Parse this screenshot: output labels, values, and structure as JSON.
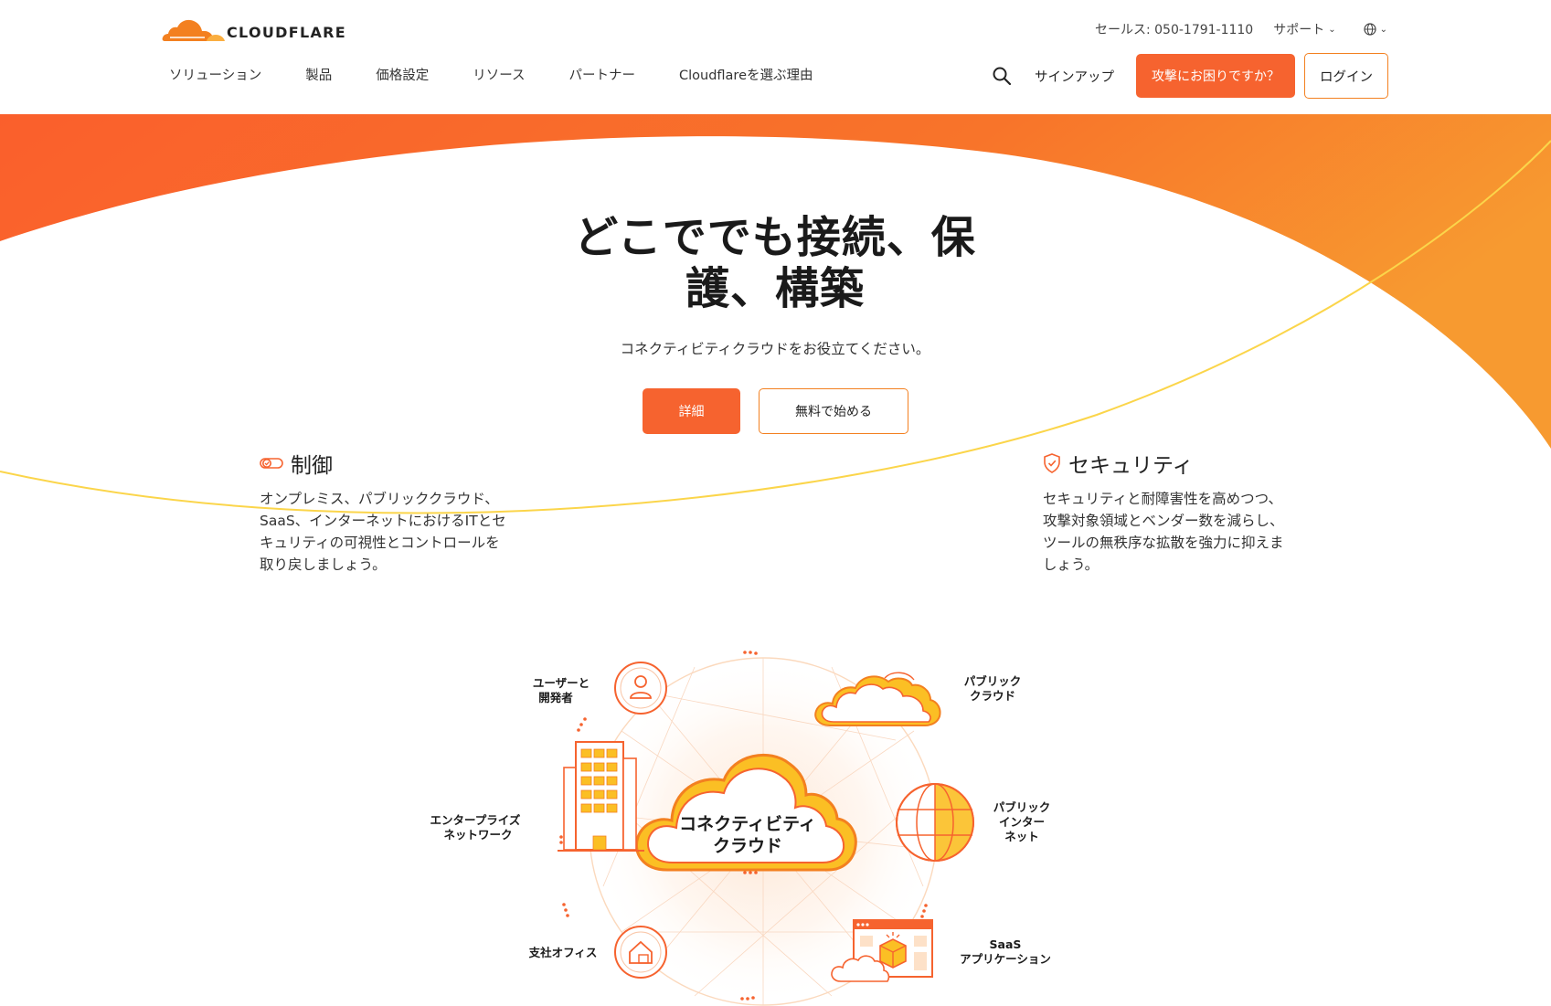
{
  "header": {
    "logo_text": "CLOUDFLARE",
    "sales": "セールス: 050-1791-1110",
    "support": "サポート",
    "nav": [
      "ソリューション",
      "製品",
      "価格設定",
      "リソース",
      "パートナー",
      "Cloudflareを選ぶ理由"
    ],
    "signup": "サインアップ",
    "attack_button": "攻撃にお困りですか？",
    "login_button": "ログイン"
  },
  "hero": {
    "title_line1": "どこででも接続、保",
    "title_line2": "護、構築",
    "subtitle": "コネクティビティクラウドをお役立てください。",
    "detail_button": "詳細",
    "free_button": "無料で始める"
  },
  "features": {
    "control": {
      "title": "制御",
      "lines": [
        "オンプレミス、パブリッククラウド、",
        "SaaS、インターネットにおけるITとセ",
        "キュリティの可視性とコントロールを",
        "取り戻しましょう。"
      ]
    },
    "security": {
      "title": "セキュリティ",
      "lines": [
        "セキュリティと耐障害性を高めつつ、",
        "攻撃対象領域とベンダー数を減らし、",
        "ツールの無秩序な拡散を強力に抑えま",
        "しょう。"
      ]
    }
  },
  "diagram": {
    "center": [
      "コネクティビティ",
      "クラウド"
    ],
    "users": [
      "ユーザーと",
      "開発者"
    ],
    "public_cloud": [
      "パブリック",
      "クラウド"
    ],
    "enterprise": [
      "エンタープライズ",
      "ネットワーク"
    ],
    "public_internet": [
      "パブリック",
      "インター",
      "ネット"
    ],
    "branch": [
      "支社オフィス"
    ],
    "saas": [
      "SaaS",
      "アプリケーション"
    ]
  },
  "colors": {
    "accent": "#f6632f",
    "orange": "#f38020",
    "gold": "#fbbf24",
    "text": "#222222"
  },
  "icons": [
    "cloudflare-logo-icon",
    "chevron-down-icon",
    "globe-icon",
    "search-icon",
    "toggle-icon",
    "shield-icon",
    "user-icon",
    "cloud-icon",
    "building-icon",
    "globe-sphere-icon",
    "house-icon",
    "app-window-icon"
  ]
}
